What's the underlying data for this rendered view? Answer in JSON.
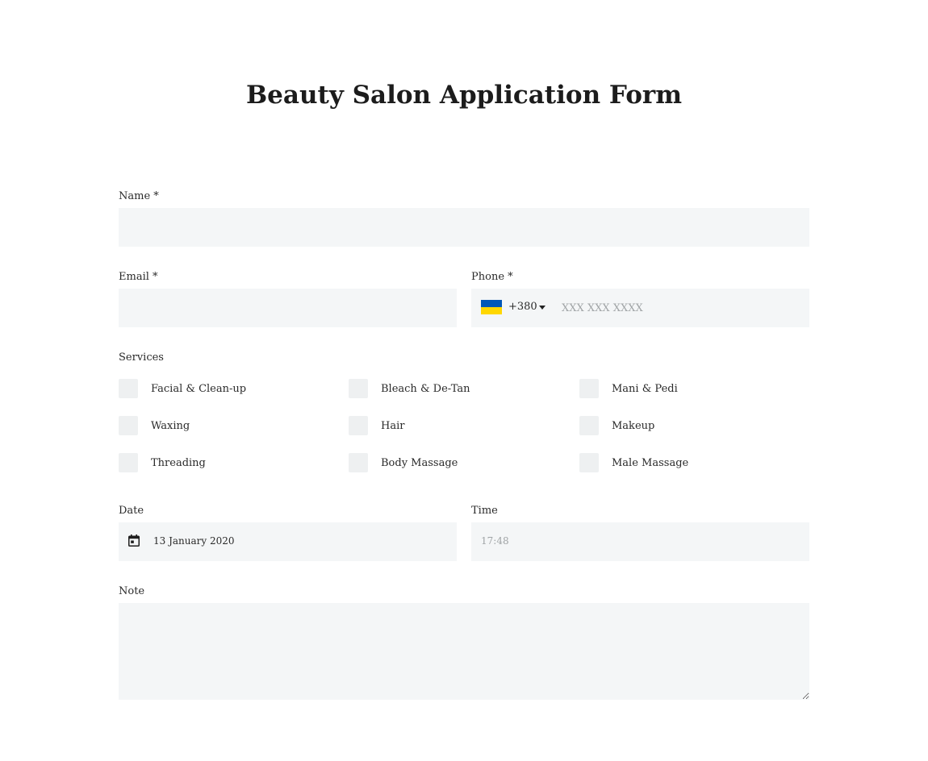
{
  "form": {
    "title": "Beauty Salon Application Form",
    "name_label": "Name  *",
    "name_value": "",
    "email_label": "Email *",
    "email_value": "",
    "phone_label": "Phone *",
    "phone_country_flag": "ukraine-flag-icon",
    "phone_dial_code": "+380",
    "phone_placeholder": "XXX XXX XXXX",
    "services_label": "Services",
    "services": [
      {
        "label": "Facial & Clean-up",
        "checked": false
      },
      {
        "label": "Bleach & De-Tan",
        "checked": false
      },
      {
        "label": "Mani & Pedi",
        "checked": false
      },
      {
        "label": "Waxing",
        "checked": false
      },
      {
        "label": "Hair",
        "checked": false
      },
      {
        "label": "Makeup",
        "checked": false
      },
      {
        "label": "Threading",
        "checked": false
      },
      {
        "label": "Body Massage",
        "checked": false
      },
      {
        "label": "Male Massage",
        "checked": false
      }
    ],
    "date_label": "Date",
    "date_value": "13 January 2020",
    "time_label": "Time",
    "time_placeholder": "17:48",
    "note_label": "Note",
    "note_value": ""
  },
  "colors": {
    "field_background": "#f4f6f7",
    "checkbox_background": "#eef0f1",
    "flag_blue": "#0057b7",
    "flag_yellow": "#ffd700",
    "text": "#2a2a2a",
    "placeholder": "#a0a4a6"
  }
}
